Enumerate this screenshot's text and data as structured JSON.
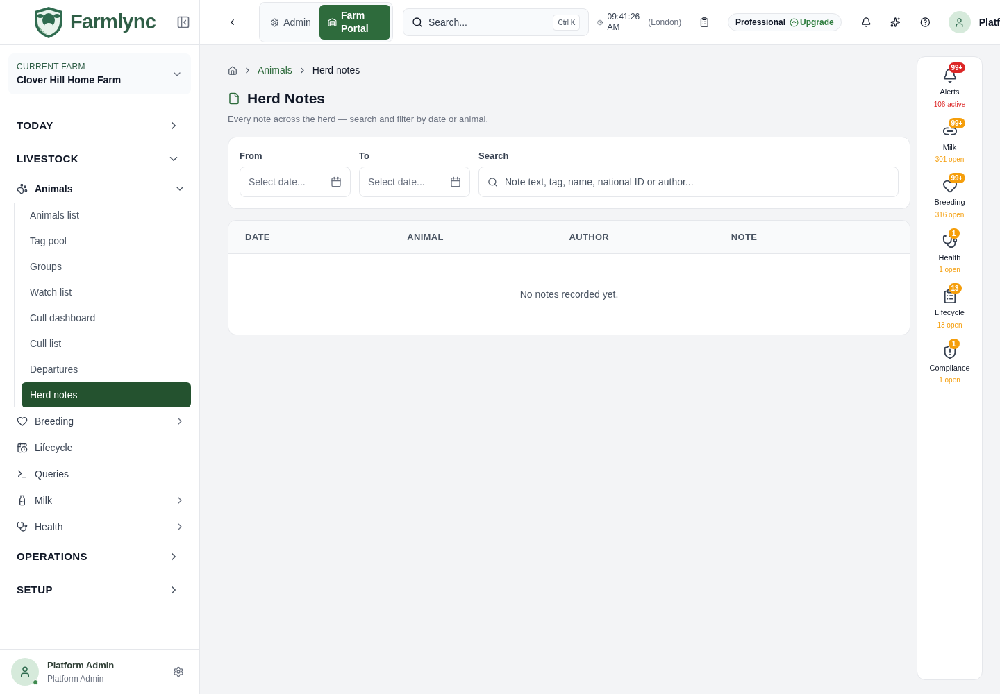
{
  "brand": {
    "name": "Farmlync"
  },
  "farm": {
    "label": "CURRENT FARM",
    "name": "Clover Hill Home Farm"
  },
  "nav": [
    {
      "title": "TODAY",
      "expanded": false
    },
    {
      "title": "LIVESTOCK",
      "expanded": true,
      "children": [
        {
          "kind": "group",
          "label": "Animals",
          "expanded": true,
          "children": [
            {
              "label": "Animals list",
              "selected": false
            },
            {
              "label": "Tag pool",
              "selected": false
            },
            {
              "label": "Groups",
              "selected": false
            },
            {
              "label": "Watch list",
              "selected": false
            },
            {
              "label": "Cull dashboard",
              "selected": false
            },
            {
              "label": "Cull list",
              "selected": false
            },
            {
              "label": "Departures",
              "selected": false
            },
            {
              "label": "Herd notes",
              "selected": true
            }
          ]
        },
        {
          "kind": "group",
          "label": "Breeding",
          "expanded": false
        },
        {
          "kind": "link",
          "label": "Lifecycle"
        },
        {
          "kind": "link",
          "label": "Queries"
        },
        {
          "kind": "group",
          "label": "Milk",
          "expanded": false
        },
        {
          "kind": "group",
          "label": "Health",
          "expanded": false
        }
      ]
    },
    {
      "title": "OPERATIONS",
      "expanded": false
    },
    {
      "title": "SETUP",
      "expanded": false
    }
  ],
  "user": {
    "name": "Platform Admin",
    "role": "Platform Admin"
  },
  "topbar": {
    "modes": [
      {
        "label": "Admin",
        "selected": false
      },
      {
        "label": "Farm Portal",
        "selected": true
      }
    ],
    "search": {
      "placeholder": "Search...",
      "shortcut": "Ctrl K"
    },
    "time": "09:41:26 AM",
    "timezone": "(London)",
    "plan": "Professional",
    "upgrade": "Upgrade",
    "user_name": "Platf"
  },
  "breadcrumb": [
    "Animals",
    "Herd notes"
  ],
  "page": {
    "title": "Herd Notes",
    "subtitle": "Every note across the herd — search and filter by date or animal."
  },
  "filters": [
    {
      "kind": "date",
      "label": "From",
      "placeholder": "Select date..."
    },
    {
      "kind": "date",
      "label": "To",
      "placeholder": "Select date..."
    },
    {
      "kind": "search",
      "label": "Search",
      "placeholder": "Note text, tag, name, national ID or author..."
    }
  ],
  "table": {
    "columns": [
      "DATE",
      "ANIMAL",
      "AUTHOR",
      "NOTE"
    ],
    "empty": "No notes recorded yet."
  },
  "rail": [
    {
      "label": "Alerts",
      "badge": "99+",
      "status": "106 active",
      "color": "#dc2626"
    },
    {
      "label": "Milk",
      "badge": "99+",
      "status": "301 open",
      "color": "#f59e0b"
    },
    {
      "label": "Breeding",
      "badge": "99+",
      "status": "316 open",
      "color": "#f59e0b"
    },
    {
      "label": "Health",
      "badge": "1",
      "status": "1 open",
      "color": "#f59e0b"
    },
    {
      "label": "Lifecycle",
      "badge": "13",
      "status": "13 open",
      "color": "#f59e0b"
    },
    {
      "label": "Compliance",
      "badge": "1",
      "status": "1 open",
      "color": "#f59e0b"
    }
  ]
}
